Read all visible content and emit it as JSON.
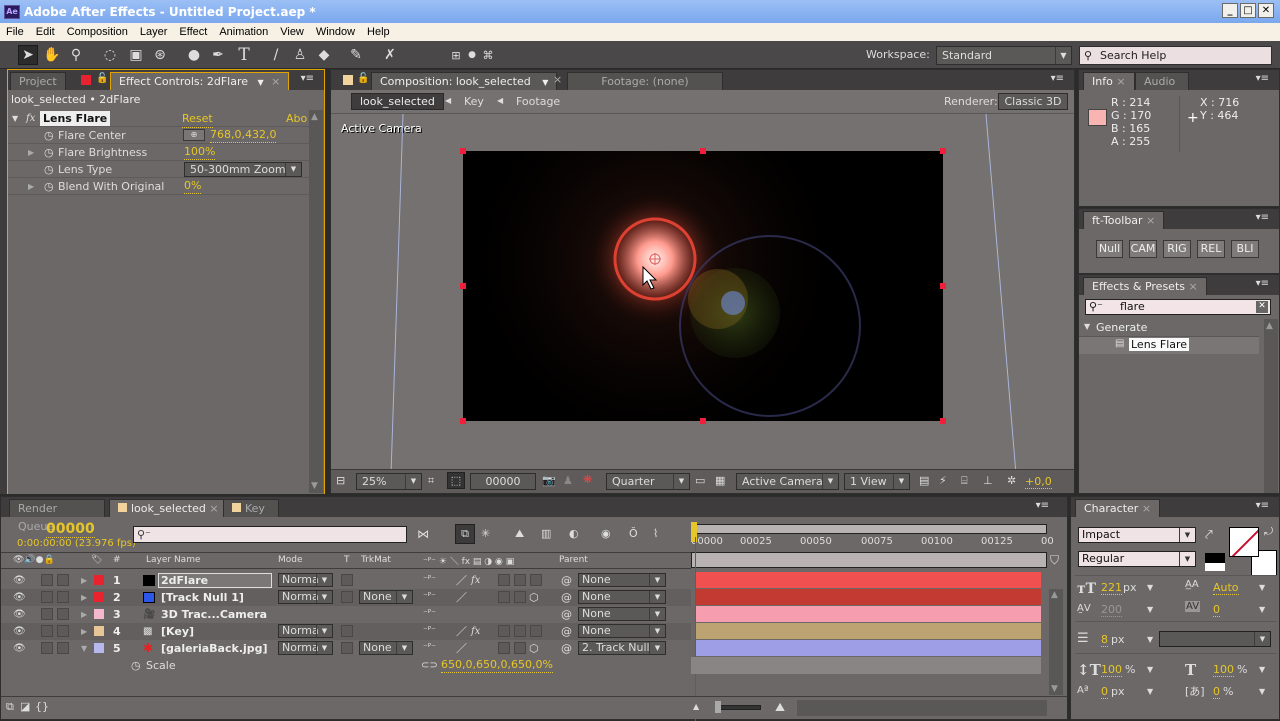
{
  "window": {
    "app_icon": "Ae",
    "title": "Adobe After Effects - Untitled Project.aep *",
    "controls": [
      "minimize",
      "maximize",
      "close"
    ]
  },
  "menu": [
    "File",
    "Edit",
    "Composition",
    "Layer",
    "Effect",
    "Animation",
    "View",
    "Window",
    "Help"
  ],
  "toolbar": {
    "tools": [
      "selection-tool",
      "hand-tool",
      "zoom-tool",
      "rotation-tool",
      "camera-tool",
      "pan-behind-tool",
      "ellipse-tool",
      "pen-tool",
      "type-tool",
      "brush-tool",
      "clone-stamp-tool",
      "eraser-tool",
      "roto-brush-tool",
      "puppet-pin-tool"
    ],
    "workspace_label": "Workspace:",
    "workspace_value": "Standard",
    "search_placeholder": "Search Help"
  },
  "effect_controls": {
    "tabs": [
      {
        "label": "Project"
      },
      {
        "label": "Effect Controls: 2dFlare"
      }
    ],
    "breadcrumb": "look_selected • 2dFlare",
    "effect_name": "Lens Flare",
    "reset_label": "Reset",
    "about_label": "Abo",
    "properties": [
      {
        "name": "Flare Center",
        "value": "768,0,432,0",
        "expandable": false
      },
      {
        "name": "Flare Brightness",
        "value": "100%",
        "expandable": true
      },
      {
        "name": "Lens Type",
        "value": "50-300mm Zoom",
        "expandable": false
      },
      {
        "name": "Blend With Original",
        "value": "0%",
        "expandable": true
      }
    ]
  },
  "composition": {
    "tabs": [
      {
        "label": "Composition: look_selected"
      },
      {
        "label": "Footage: (none)"
      }
    ],
    "nav": [
      "look_selected",
      "Key",
      "Footage"
    ],
    "renderer_label": "Renderer:",
    "renderer_value": "Classic 3D",
    "view_label": "Active Camera",
    "footer": {
      "zoom": "25%",
      "timecode": "00000",
      "resolution": "Quarter",
      "camera": "Active Camera",
      "views": "1 View",
      "exposure": "+0,0"
    }
  },
  "info": {
    "tabs": [
      "Info",
      "Audio"
    ],
    "swatch_color": "#f7b4b0",
    "r": "R : 214",
    "g": "G : 170",
    "b": "B : 165",
    "a": "A : 255",
    "x": "X : 716",
    "y": "Y : 464"
  },
  "ft_toolbar": {
    "title": "ft-Toolbar",
    "buttons": [
      "Null",
      "CAM",
      "RIG",
      "REL",
      "BLI"
    ]
  },
  "effects_presets": {
    "title": "Effects & Presets",
    "search_value": "flare",
    "category": "Generate",
    "item": "Lens Flare"
  },
  "timeline": {
    "tabs": [
      {
        "label": "Render Queue"
      },
      {
        "label": "look_selected"
      },
      {
        "label": "Key"
      }
    ],
    "current_frame": "00000",
    "timecode": "0:00:00:00 (23.976 fps)",
    "columns": {
      "name": "Layer Name",
      "mode": "Mode",
      "t": "T",
      "trkmat": "TrkMat",
      "parent": "Parent",
      "num": "#"
    },
    "ruler": [
      "00000",
      "00025",
      "00050",
      "00075",
      "00100",
      "00125",
      "00"
    ],
    "layers": [
      {
        "num": "1",
        "name": "2dFlare",
        "label_color": "#e8232f",
        "mode": "Norma",
        "trkmat": "",
        "parent": "None",
        "bar_color": "#f05050",
        "selected": true
      },
      {
        "num": "2",
        "name": "[Track Null 1]",
        "label_color": "#e8232f",
        "mode": "Norma",
        "trkmat": "None",
        "parent": "None",
        "bar_color": "#c23a32"
      },
      {
        "num": "3",
        "name": "3D Trac...Camera",
        "label_color": "#f3b8cd",
        "mode": "",
        "trkmat": "",
        "parent": "None",
        "bar_color": "#f79db0"
      },
      {
        "num": "4",
        "name": "[Key]",
        "label_color": "#e6c795",
        "mode": "Norma",
        "trkmat": "",
        "parent": "None",
        "bar_color": "#bda272"
      },
      {
        "num": "5",
        "name": "[galeriaBack.jpg]",
        "label_color": "#b6b8ee",
        "mode": "Norma",
        "trkmat": "None",
        "parent": "2. Track Null",
        "bar_color": "#9e9ee6"
      }
    ],
    "sub_property": {
      "name": "Scale",
      "value": "650,0,650,0,650,0%"
    }
  },
  "character": {
    "title": "Character",
    "font": "Impact",
    "style": "Regular",
    "size": "221",
    "size_unit": "px",
    "leading": "Auto",
    "kerning": "200",
    "tracking": "0",
    "stroke": "8",
    "stroke_unit": "px",
    "vscale": "100",
    "hscale": "100",
    "baseline": "0",
    "baseline_unit": "px",
    "tsume": "0",
    "pct": "%"
  }
}
